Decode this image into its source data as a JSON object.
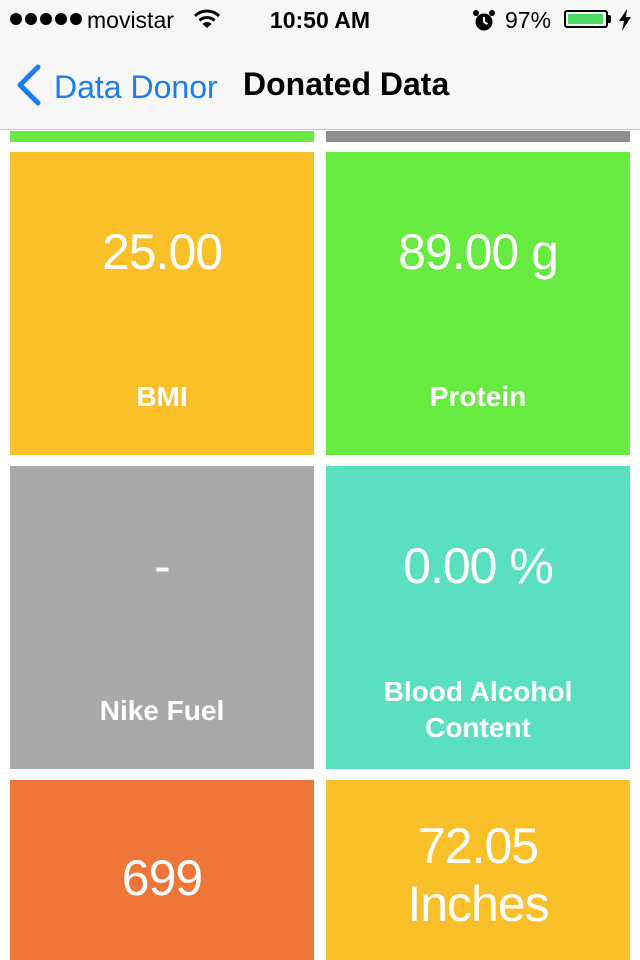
{
  "status_bar": {
    "carrier": "movistar",
    "time": "10:50 AM",
    "battery_percent": "97%",
    "battery_level": 0.97
  },
  "nav": {
    "back_label": "Data Donor",
    "title": "Donated Data"
  },
  "colors": {
    "yellow": "#f9c02a",
    "green": "#67eb41",
    "gray": "#a9a9a9",
    "teal": "#5ae0c1",
    "orange": "#ee7638",
    "accent_blue": "#1a7ef2"
  },
  "tiles": [
    {
      "value": "25.00",
      "label": "BMI"
    },
    {
      "value": "89.00 g",
      "label": "Protein"
    },
    {
      "value": "-",
      "label": "Nike Fuel"
    },
    {
      "value": "0.00 %",
      "label": "Blood Alcohol Content"
    },
    {
      "value": "699",
      "label": ""
    },
    {
      "value": "72.05 Inches",
      "label": ""
    }
  ]
}
